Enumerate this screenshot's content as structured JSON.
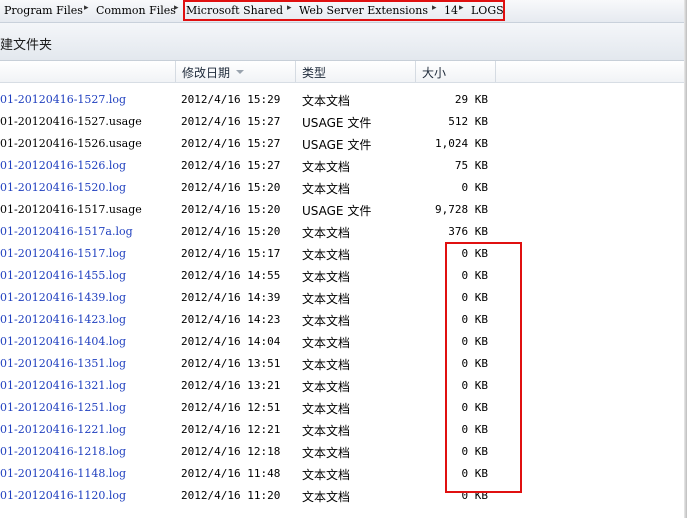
{
  "address_bar": {
    "crumbs": [
      "Program Files",
      "Common Files",
      "Microsoft Shared",
      "Web Server Extensions",
      "14",
      "LOGS"
    ]
  },
  "toolbar": {
    "new_folder_label": "建文件夹"
  },
  "columns": {
    "date_label": "修改日期",
    "type_label": "类型",
    "size_label": "大小"
  },
  "files": [
    {
      "name": "01-20120416-1527.log",
      "kind": "log",
      "date": "2012/4/16 15:29",
      "type": "文本文档",
      "size": "29 KB"
    },
    {
      "name": "01-20120416-1527.usage",
      "kind": "usage",
      "date": "2012/4/16 15:27",
      "type": "USAGE 文件",
      "size": "512 KB"
    },
    {
      "name": "01-20120416-1526.usage",
      "kind": "usage",
      "date": "2012/4/16 15:27",
      "type": "USAGE 文件",
      "size": "1,024 KB"
    },
    {
      "name": "01-20120416-1526.log",
      "kind": "log",
      "date": "2012/4/16 15:27",
      "type": "文本文档",
      "size": "75 KB"
    },
    {
      "name": "01-20120416-1520.log",
      "kind": "log",
      "date": "2012/4/16 15:20",
      "type": "文本文档",
      "size": "0 KB"
    },
    {
      "name": "01-20120416-1517.usage",
      "kind": "usage",
      "date": "2012/4/16 15:20",
      "type": "USAGE 文件",
      "size": "9,728 KB"
    },
    {
      "name": "01-20120416-1517a.log",
      "kind": "log",
      "date": "2012/4/16 15:20",
      "type": "文本文档",
      "size": "376 KB"
    },
    {
      "name": "01-20120416-1517.log",
      "kind": "log",
      "date": "2012/4/16 15:17",
      "type": "文本文档",
      "size": "0 KB"
    },
    {
      "name": "01-20120416-1455.log",
      "kind": "log",
      "date": "2012/4/16 14:55",
      "type": "文本文档",
      "size": "0 KB"
    },
    {
      "name": "01-20120416-1439.log",
      "kind": "log",
      "date": "2012/4/16 14:39",
      "type": "文本文档",
      "size": "0 KB"
    },
    {
      "name": "01-20120416-1423.log",
      "kind": "log",
      "date": "2012/4/16 14:23",
      "type": "文本文档",
      "size": "0 KB"
    },
    {
      "name": "01-20120416-1404.log",
      "kind": "log",
      "date": "2012/4/16 14:04",
      "type": "文本文档",
      "size": "0 KB"
    },
    {
      "name": "01-20120416-1351.log",
      "kind": "log",
      "date": "2012/4/16 13:51",
      "type": "文本文档",
      "size": "0 KB"
    },
    {
      "name": "01-20120416-1321.log",
      "kind": "log",
      "date": "2012/4/16 13:21",
      "type": "文本文档",
      "size": "0 KB"
    },
    {
      "name": "01-20120416-1251.log",
      "kind": "log",
      "date": "2012/4/16 12:51",
      "type": "文本文档",
      "size": "0 KB"
    },
    {
      "name": "01-20120416-1221.log",
      "kind": "log",
      "date": "2012/4/16 12:21",
      "type": "文本文档",
      "size": "0 KB"
    },
    {
      "name": "01-20120416-1218.log",
      "kind": "log",
      "date": "2012/4/16 12:18",
      "type": "文本文档",
      "size": "0 KB"
    },
    {
      "name": "01-20120416-1148.log",
      "kind": "log",
      "date": "2012/4/16 11:48",
      "type": "文本文档",
      "size": "0 KB"
    },
    {
      "name": "01-20120416-1120.log",
      "kind": "log",
      "date": "2012/4/16 11:20",
      "type": "文本文档",
      "size": "0 KB"
    }
  ],
  "colors": {
    "log_text": "#1f3fbf",
    "highlight": "#e01010"
  }
}
